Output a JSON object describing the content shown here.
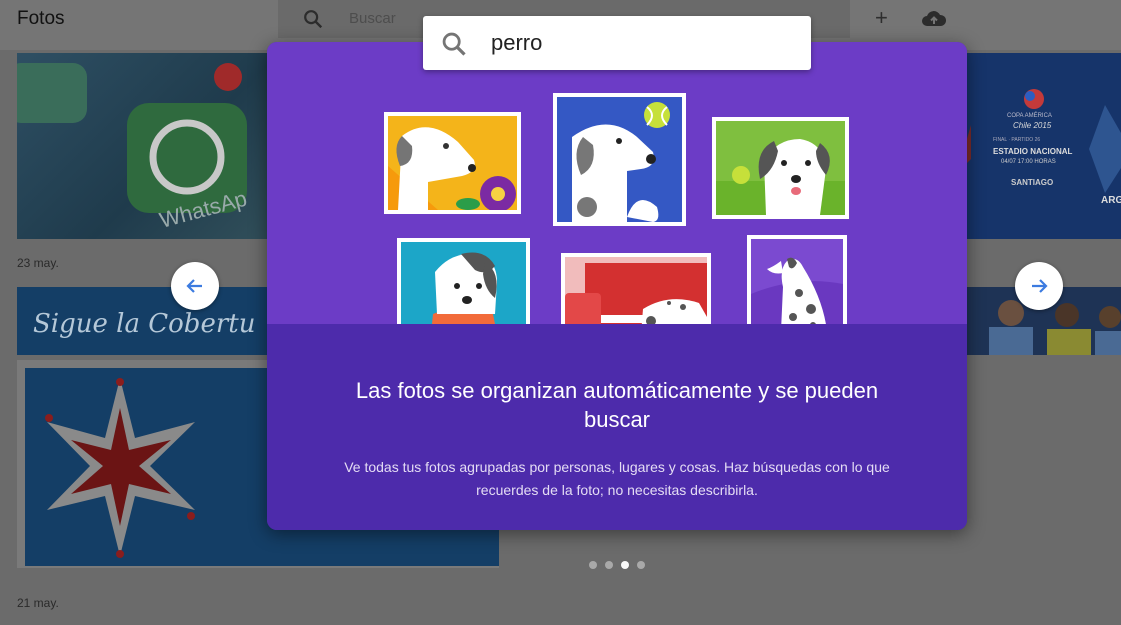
{
  "app": {
    "title": "Fotos"
  },
  "search_bar": {
    "placeholder": "Buscar",
    "icons": [
      "search-icon",
      "plus-icon",
      "upload-cloud-icon"
    ]
  },
  "gallery": {
    "dates": [
      "23 may.",
      "21 may."
    ],
    "banner_text": "Sigue la Cobertu",
    "poster": {
      "small_header": "COPA AMÉRICA",
      "brand": "Chile 2015",
      "line1": "FINAL · PARTIDO 26",
      "line2": "ESTADIO NACIONAL",
      "line3": "04/07   17:00 HORAS",
      "city": "SANTIAGO",
      "team": "ARG"
    }
  },
  "onboarding": {
    "search_query": "perro",
    "title": "Las fotos se organizan automáticamente y se pueden buscar",
    "description": "Ve todas tus fotos agrupadas por personas, lugares y cosas. Haz búsquedas con lo que recuerdes de la foto; no necesitas describirla.",
    "prev_icon": "arrow-left-icon",
    "next_icon": "arrow-right-icon",
    "pagination": {
      "total": 4,
      "active": 3
    }
  },
  "colors": {
    "card_top": "#6c3cc6",
    "card_bottom": "#4d2bab",
    "arrow": "#3c7be0"
  }
}
